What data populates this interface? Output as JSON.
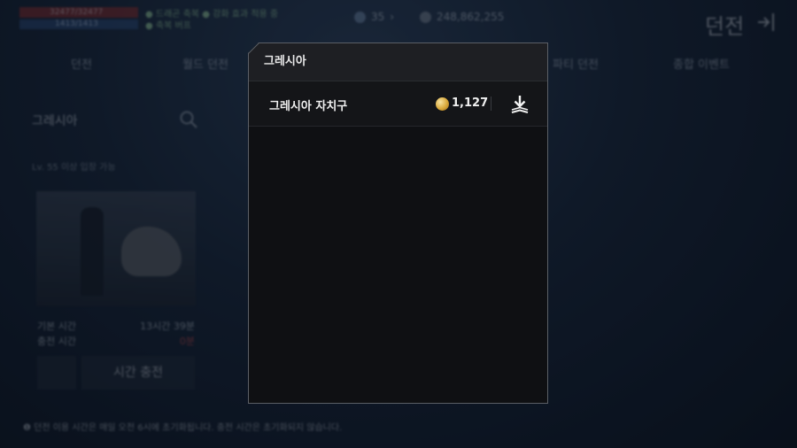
{
  "hud": {
    "hp_text": "32477/32477",
    "mp_text": "1413/1413",
    "buff_line1": "● 드래곤 축복 ● 강화 효과 적용 중",
    "buff_line2": "● 축복 버프"
  },
  "currency": {
    "gem_value": "35",
    "gold_value": "248,862,255"
  },
  "screen_title": "던전",
  "tabs": [
    "던전",
    "월드 던전",
    "",
    "파티 던전",
    "종합 이벤트"
  ],
  "region": {
    "title": "그레시아",
    "sub_note": "Lv. 55 이상 입장 가능"
  },
  "stats": [
    {
      "label": "기본 시간",
      "value": "13시간 39분"
    },
    {
      "label": "충전 시간",
      "value": "0분"
    }
  ],
  "charge_button_label": "시간 충전",
  "footer_note": "❶ 던전 이용 시간은 매일 오전 6시에 초기화됩니다. 충전 시간은 초기화되지 않습니다.",
  "modal": {
    "title": "그레시아",
    "items": [
      {
        "name": "그레시아 자치구",
        "price": "1,127",
        "icon": "download-icon"
      }
    ]
  },
  "colors": {
    "modal_bg": "#0f1013",
    "modal_header_bg": "#1e1f23",
    "coin_gold": "#d9a83a",
    "hp_red": "#8a2b2b",
    "mp_blue": "#2a4a78"
  }
}
